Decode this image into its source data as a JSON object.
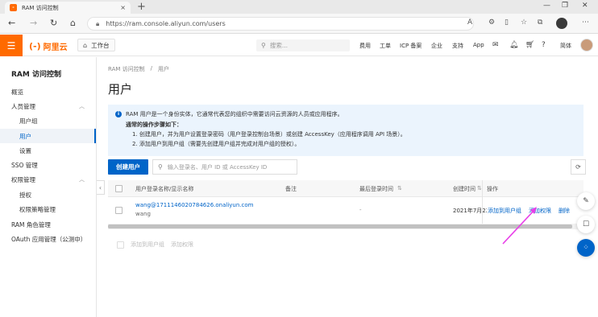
{
  "browser": {
    "tab_title": "RAM 访问控制",
    "tab_close": "×",
    "new_tab": "+",
    "url": "https://ram.console.aliyun.com/users"
  },
  "console": {
    "logo_mark": "(-)",
    "logo_text": "阿里云",
    "workbench": "工作台",
    "search_placeholder": "搜索...",
    "links": [
      "费用",
      "工单",
      "ICP 备案",
      "企业",
      "支持",
      "App"
    ],
    "language": "简体"
  },
  "sidebar": {
    "title": "RAM 访问控制",
    "items": [
      {
        "label": "概览",
        "level": 1
      },
      {
        "label": "人员管理",
        "level": 1,
        "expandable": true
      },
      {
        "label": "用户组",
        "level": 2
      },
      {
        "label": "用户",
        "level": 2,
        "active": true
      },
      {
        "label": "设置",
        "level": 2
      },
      {
        "label": "SSO 管理",
        "level": 1
      },
      {
        "label": "权限管理",
        "level": 1,
        "expandable": true
      },
      {
        "label": "授权",
        "level": 2
      },
      {
        "label": "权限策略管理",
        "level": 2
      },
      {
        "label": "RAM 角色管理",
        "level": 1
      },
      {
        "label": "OAuth 应用管理（公测中）",
        "level": 1
      }
    ]
  },
  "main": {
    "breadcrumb": [
      "RAM 访问控制",
      "/",
      "用户"
    ],
    "title": "用户",
    "notice": {
      "line1": "RAM 用户是一个身份实体，它通常代表您的组织中需要访问云资源的人员或应用程序。",
      "heading": "通常的操作步骤如下：",
      "step1": "1. 创建用户，并为用户设置登录密码（用户登录控制台场景）或创建 AccessKey（应用程序调用 API 场景）。",
      "step2": "2. 添加用户到用户组（需要先创建用户组并完成对用户组的授权）。"
    },
    "create_button": "创建用户",
    "filter_placeholder": "输入登录名、用户 ID 或 AccessKey ID",
    "table": {
      "headers": [
        "用户登录名称/显示名称",
        "备注",
        "最后登录时间",
        "创建时间",
        "操作"
      ],
      "rows": [
        {
          "login": "wang@1711146020784626.onaliyun.com",
          "display": "wang",
          "remark": "",
          "last_login": "-",
          "created": "2021年7月22",
          "actions": [
            "添加到用户组",
            "添加权限",
            "删除"
          ]
        }
      ]
    },
    "batch_actions": [
      "添加到用户组",
      "添加权限"
    ]
  },
  "colors": {
    "brand": "#ff6a00",
    "primary": "#0064c8",
    "notice_bg": "#ebf4fd",
    "annotation_arrow": "#e83ee8"
  }
}
